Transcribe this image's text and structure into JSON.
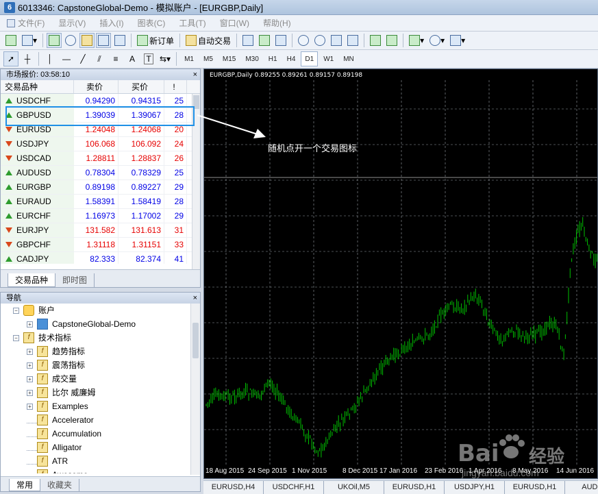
{
  "window": {
    "title": "6013346: CapstoneGlobal-Demo - 模拟账户 - [EURGBP,Daily]",
    "icon_text": "6"
  },
  "menu": [
    "文件(F)",
    "显示(V)",
    "插入(I)",
    "图表(C)",
    "工具(T)",
    "窗口(W)",
    "帮助(H)"
  ],
  "toolbar": {
    "new_order": "新订单",
    "auto_trading": "自动交易"
  },
  "drawing_tools": {
    "text_tool": "A",
    "label_tool": "T"
  },
  "timeframes": [
    "M1",
    "M5",
    "M15",
    "M30",
    "H1",
    "H4",
    "D1",
    "W1",
    "MN"
  ],
  "active_timeframe": "D1",
  "market_watch": {
    "header": "市场报价: 03:58:10",
    "close": "×",
    "columns": {
      "symbol": "交易品种",
      "bid": "卖价",
      "ask": "买价",
      "spread": "!"
    },
    "rows": [
      {
        "symbol": "USDCHF",
        "bid": "0.94290",
        "ask": "0.94315",
        "spread": "25",
        "dir": "up",
        "color": "blue"
      },
      {
        "symbol": "GBPUSD",
        "bid": "1.39039",
        "ask": "1.39067",
        "spread": "28",
        "dir": "up",
        "color": "blue"
      },
      {
        "symbol": "EURUSD",
        "bid": "1.24048",
        "ask": "1.24068",
        "spread": "20",
        "dir": "down",
        "color": "red"
      },
      {
        "symbol": "USDJPY",
        "bid": "106.068",
        "ask": "106.092",
        "spread": "24",
        "dir": "down",
        "color": "red"
      },
      {
        "symbol": "USDCAD",
        "bid": "1.28811",
        "ask": "1.28837",
        "spread": "26",
        "dir": "down",
        "color": "red"
      },
      {
        "symbol": "AUDUSD",
        "bid": "0.78304",
        "ask": "0.78329",
        "spread": "25",
        "dir": "up",
        "color": "blue"
      },
      {
        "symbol": "EURGBP",
        "bid": "0.89198",
        "ask": "0.89227",
        "spread": "29",
        "dir": "up",
        "color": "blue"
      },
      {
        "symbol": "EURAUD",
        "bid": "1.58391",
        "ask": "1.58419",
        "spread": "28",
        "dir": "up",
        "color": "blue"
      },
      {
        "symbol": "EURCHF",
        "bid": "1.16973",
        "ask": "1.17002",
        "spread": "29",
        "dir": "up",
        "color": "blue"
      },
      {
        "symbol": "EURJPY",
        "bid": "131.582",
        "ask": "131.613",
        "spread": "31",
        "dir": "down",
        "color": "red"
      },
      {
        "symbol": "GBPCHF",
        "bid": "1.31118",
        "ask": "1.31151",
        "spread": "33",
        "dir": "down",
        "color": "red"
      },
      {
        "symbol": "CADJPY",
        "bid": "82.333",
        "ask": "82.374",
        "spread": "41",
        "dir": "up",
        "color": "blue"
      }
    ],
    "tabs": [
      "交易品种",
      "即时图"
    ],
    "active_tab": 0
  },
  "navigator": {
    "header": "导航",
    "close": "×",
    "items": [
      {
        "label": "账户",
        "level": 0,
        "expander": "−",
        "icon": "accounts-icon",
        "glyph": ""
      },
      {
        "label": "CapstoneGlobal-Demo",
        "level": 1,
        "expander": "+",
        "icon": "demo-account-icon",
        "glyph": ""
      },
      {
        "label": "技术指标",
        "level": 0,
        "expander": "−",
        "icon": "indicator-folder-icon",
        "glyph": "f"
      },
      {
        "label": "趋势指标",
        "level": 1,
        "expander": "+",
        "icon": "indicator-folder-icon",
        "glyph": "f"
      },
      {
        "label": "震荡指标",
        "level": 1,
        "expander": "+",
        "icon": "indicator-folder-icon",
        "glyph": "f"
      },
      {
        "label": "成交量",
        "level": 1,
        "expander": "+",
        "icon": "indicator-folder-icon",
        "glyph": "f"
      },
      {
        "label": "比尔 威廉姆",
        "level": 1,
        "expander": "+",
        "icon": "indicator-folder-icon",
        "glyph": "f"
      },
      {
        "label": "Examples",
        "level": 1,
        "expander": "+",
        "icon": "indicator-folder-icon",
        "glyph": "f"
      },
      {
        "label": "Accelerator",
        "level": 1,
        "expander": "",
        "icon": "indicator-icon",
        "glyph": "f"
      },
      {
        "label": "Accumulation",
        "level": 1,
        "expander": "",
        "icon": "indicator-icon",
        "glyph": "f"
      },
      {
        "label": "Alligator",
        "level": 1,
        "expander": "",
        "icon": "indicator-icon",
        "glyph": "f"
      },
      {
        "label": "ATR",
        "level": 1,
        "expander": "",
        "icon": "indicator-icon",
        "glyph": "f"
      },
      {
        "label": "Awesome",
        "level": 1,
        "expander": "",
        "icon": "indicator-icon",
        "glyph": "f"
      }
    ],
    "tabs": [
      "常用",
      "收藏夹"
    ],
    "active_tab": 0
  },
  "chart": {
    "title": "EURGBP,Daily  0.89255 0.89261 0.89157 0.89198",
    "x_labels": [
      "18 Aug 2015",
      "24 Sep 2015",
      "1 Nov 2015",
      "8 Dec 2015",
      "17 Jan 2016",
      "23 Feb 2016",
      "1 Apr 2016",
      "8 May 2016",
      "14 Jun 2016"
    ],
    "candle_color": "#00c000",
    "grid_color": "#9aa0a6",
    "bg_color": "#000000"
  },
  "chart_tabs": [
    "EURUSD,H4",
    "USDCHF,H1",
    "UKOil,M5",
    "EURUSD,H1",
    "USDJPY,H1",
    "EURUSD,H1",
    "AUDUS"
  ],
  "annotation": {
    "text": "随机点开一个交易图标"
  },
  "watermark": {
    "brand": "Bai",
    "brand2": "经验",
    "url": "jingyan.baidu.com"
  }
}
